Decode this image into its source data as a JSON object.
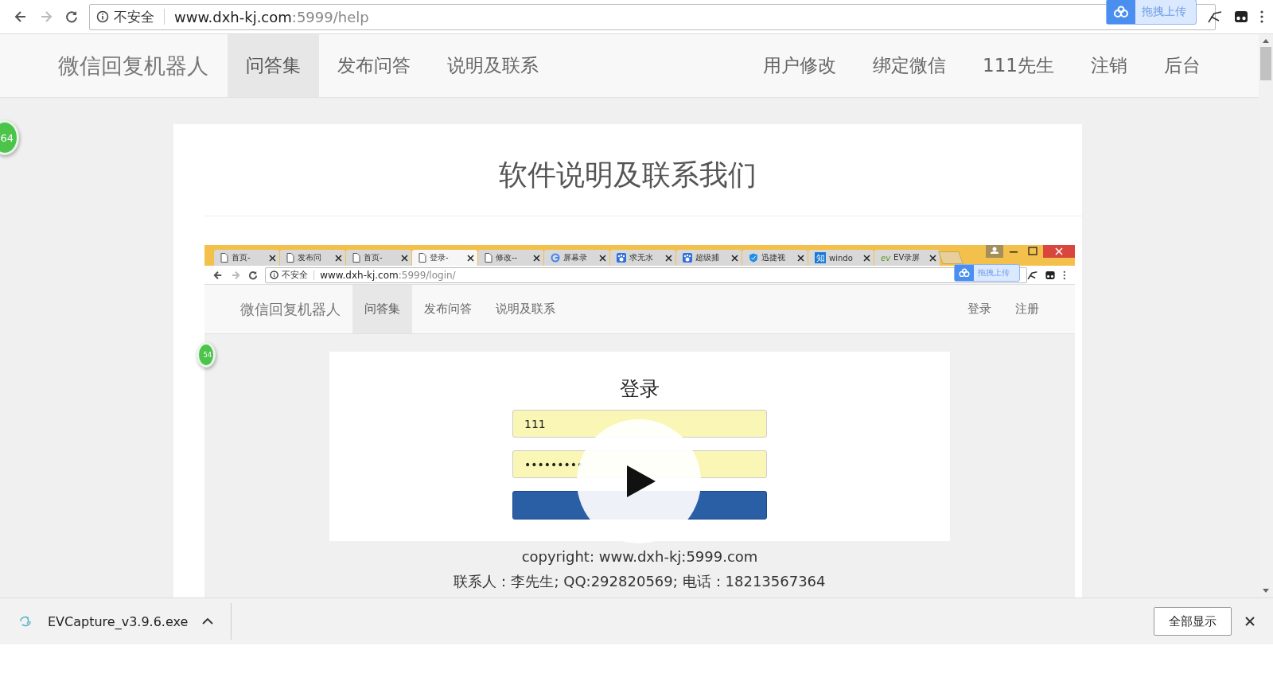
{
  "browser": {
    "security": "不安全",
    "url_host": "www.dxh-kj.com",
    "url_rest": ":5999/help",
    "extension": "拖拽上传"
  },
  "navbar": {
    "brand": "微信回复机器人",
    "left": [
      {
        "label": "问答集",
        "selected": true
      },
      {
        "label": "发布问答",
        "selected": false
      },
      {
        "label": "说明及联系",
        "selected": false
      }
    ],
    "right": [
      "用户修改",
      "绑定微信",
      "111先生",
      "注销",
      "后台"
    ]
  },
  "side_badge": "64",
  "card": {
    "title": "软件说明及联系我们",
    "screenshot": {
      "tabs": [
        {
          "label": "首页-",
          "kind": "page",
          "selected": false
        },
        {
          "label": "发布问",
          "kind": "page",
          "selected": false
        },
        {
          "label": "首页-",
          "kind": "page",
          "selected": false
        },
        {
          "label": "登录-",
          "kind": "page",
          "selected": true
        },
        {
          "label": "修改--",
          "kind": "page",
          "selected": false
        },
        {
          "label": "屏幕录",
          "kind": "google",
          "selected": false
        },
        {
          "label": "求无水",
          "kind": "paw",
          "selected": false
        },
        {
          "label": "超级捕",
          "kind": "paw",
          "selected": false
        },
        {
          "label": "迅捷视",
          "kind": "shield",
          "selected": false
        },
        {
          "label": "windo",
          "kind": "square",
          "icon_text": "知",
          "selected": false
        },
        {
          "label": "EV录屏",
          "kind": "mark",
          "icon_text": "ev",
          "selected": false
        }
      ],
      "security": "不安全",
      "url_host": "www.dxh-kj.com",
      "url_rest": ":5999/login/",
      "extension": "拖拽上传",
      "navbar": {
        "brand": "微信回复机器人",
        "left": [
          {
            "label": "问答集",
            "selected": true
          },
          {
            "label": "发布问答",
            "selected": false
          },
          {
            "label": "说明及联系",
            "selected": false
          }
        ],
        "right": [
          "登录",
          "注册"
        ]
      },
      "side_badge": "54",
      "login": {
        "title": "登录",
        "username": "111",
        "password": "•••••••••"
      },
      "footer": [
        "copyright: www.dxh-kj:5999.com",
        "联系人：李先生; QQ:292820569; 电话：18213567364"
      ]
    }
  },
  "downloads": {
    "file": "EVCapture_v3.9.6.exe",
    "button": "全部显示"
  }
}
